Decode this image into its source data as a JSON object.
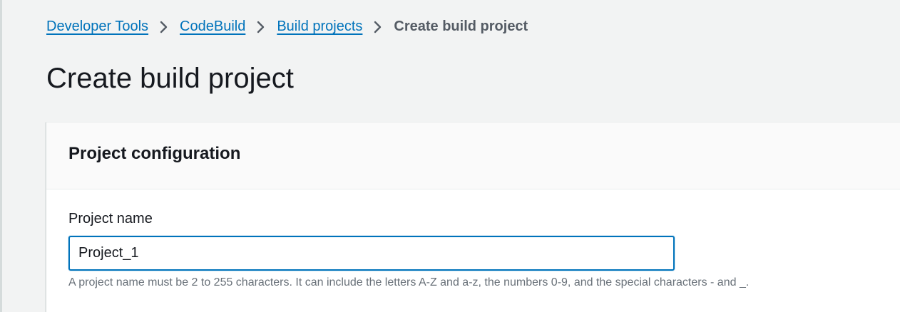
{
  "breadcrumb": {
    "items": [
      {
        "label": "Developer Tools"
      },
      {
        "label": "CodeBuild"
      },
      {
        "label": "Build projects"
      }
    ],
    "current": "Create build project",
    "separator_icon": "chevron-right-icon"
  },
  "page": {
    "title": "Create build project"
  },
  "project_configuration": {
    "title": "Project configuration",
    "project_name": {
      "label": "Project name",
      "value": "Project_1",
      "hint": "A project name must be 2 to 255 characters. It can include the letters A-Z and a-z, the numbers 0-9, and the special characters - and _."
    }
  },
  "colors": {
    "link": "#0073bb",
    "focus_border": "#0073bb",
    "background": "#f2f3f3",
    "text": "#16191f",
    "muted_text": "#687078"
  }
}
